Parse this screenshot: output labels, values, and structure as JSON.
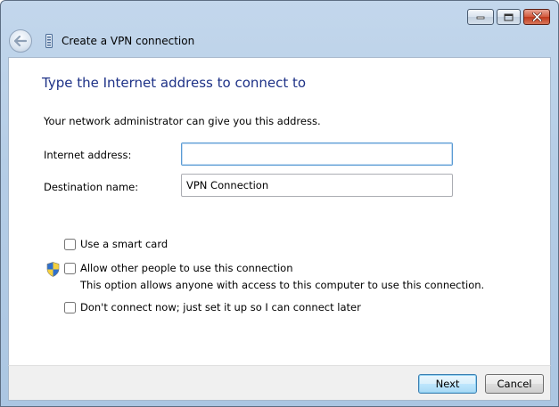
{
  "window": {
    "title": "Create a VPN connection"
  },
  "content": {
    "heading": "Type the Internet address to connect to",
    "intro": "Your network administrator can give you this address.",
    "fields": {
      "internet_address": {
        "label": "Internet address:",
        "value": ""
      },
      "destination_name": {
        "label": "Destination name:",
        "value": "VPN Connection"
      }
    },
    "options": {
      "smart_card": {
        "label": "Use a smart card",
        "checked": false
      },
      "allow_others": {
        "label": "Allow other people to use this connection",
        "description": "This option allows anyone with access to this computer to use this connection.",
        "checked": false
      },
      "connect_later": {
        "label": "Don't connect now; just set it up so I can connect later",
        "checked": false
      }
    }
  },
  "footer": {
    "next_label": "Next",
    "cancel_label": "Cancel"
  },
  "icons": {
    "back": "back-arrow-icon",
    "vpn": "vpn-connection-icon",
    "shield": "uac-shield-icon",
    "minimize": "minimize-icon",
    "maximize": "maximize-icon",
    "close": "close-icon"
  },
  "colors": {
    "heading": "#1e3287",
    "frame": "#b5cde6",
    "close_button": "#c0381b",
    "default_button_border": "#3c7fb1"
  }
}
